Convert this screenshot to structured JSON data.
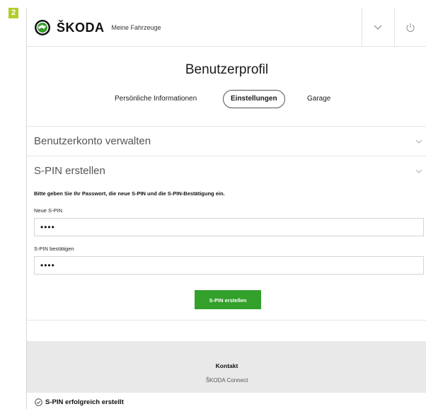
{
  "step_badge": "2",
  "header": {
    "brand": "ŠKODA",
    "nav_title": "Meine Fahrzeuge"
  },
  "page_title": "Benutzerprofil",
  "tabs": [
    {
      "label": "Persönliche Informationen",
      "active": false
    },
    {
      "label": "Einstellungen",
      "active": true
    },
    {
      "label": "Garage",
      "active": false
    }
  ],
  "sections": {
    "account": {
      "title": "Benutzerkonto verwalten"
    },
    "spin": {
      "title": "S-PIN erstellen",
      "instruction": "Bitte geben Sie Ihr Passwort, die neue S-PIN und die S-PIN-Bestätigung ein.",
      "new_pin_label": "Neue S-PIN",
      "new_pin_value": "••••",
      "confirm_label": "S-PIN bestätigen",
      "confirm_value": "••••",
      "submit_label": "S-PIN erstellen"
    }
  },
  "footer": {
    "title": "Kontakt",
    "subtitle": "ŠKODA Connect"
  },
  "toast": "S-PIN erfolgreich erstellt",
  "colors": {
    "accent_green": "#33a02c",
    "badge": "#b5cc2e",
    "footer_bg": "#e9e9e9"
  }
}
